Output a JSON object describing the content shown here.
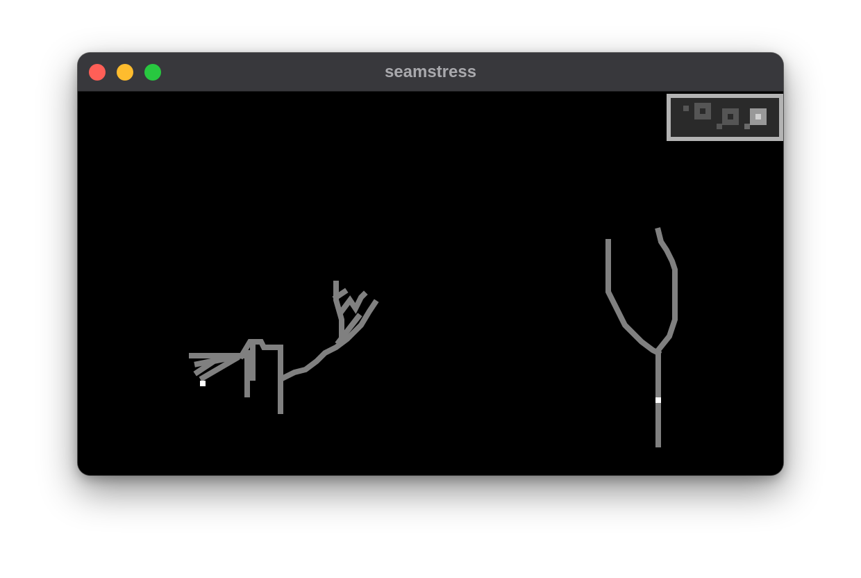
{
  "window": {
    "title": "seamstress",
    "controls": [
      "close",
      "minimize",
      "zoom"
    ]
  },
  "canvas": {
    "background": "#000000",
    "stroke_color": "#808080",
    "cursor_color": "#ffffff",
    "indicator_frame_color": "#b3b3b3",
    "indicator_fill_color": "#2a2a2a"
  }
}
